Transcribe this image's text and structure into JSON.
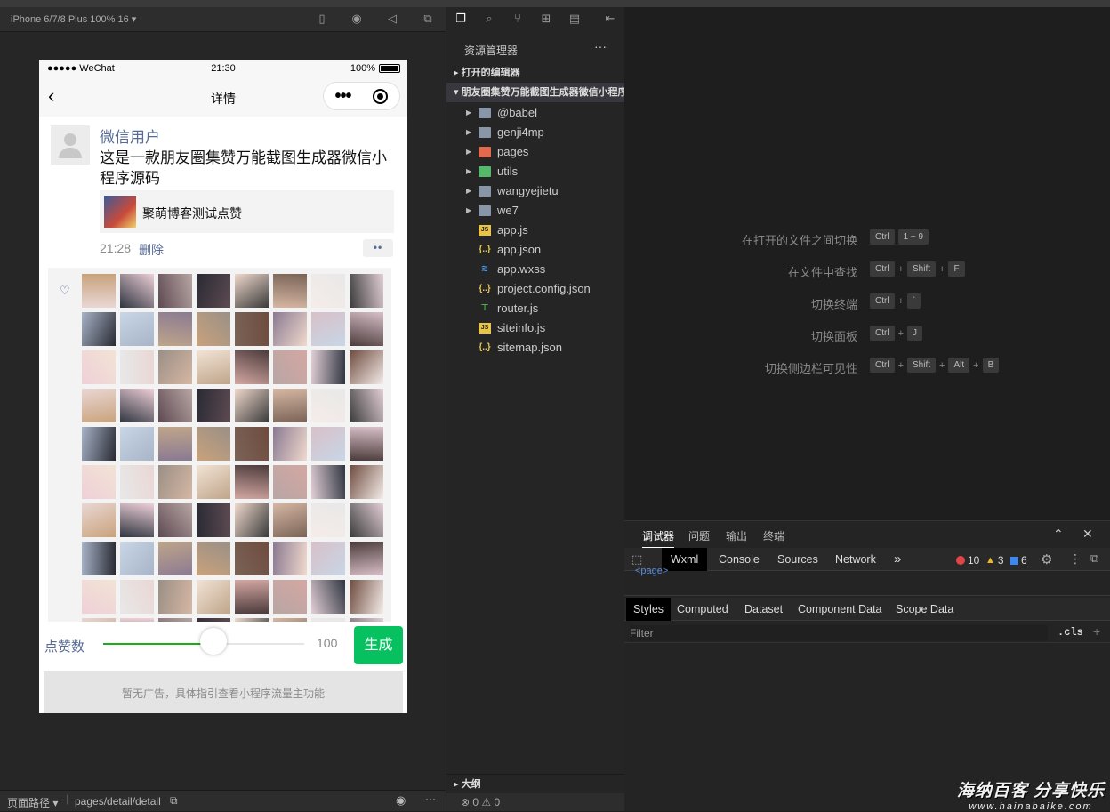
{
  "simulator": {
    "device_label": "iPhone 6/7/8 Plus 100% 16 ▾",
    "footer_path_label": "页面路径 ▾",
    "footer_path": "pages/detail/detail"
  },
  "phone": {
    "status": {
      "carrier": "●●●●● WeChat",
      "time": "21:30",
      "battery_pct": "100%"
    },
    "nav": {
      "back": "‹",
      "title": "详情",
      "capsule_dots": "•••"
    },
    "post": {
      "username": "微信用户",
      "text": "这是一款朋友圈集赞万能截图生成器微信小程序源码",
      "link_title": "聚萌博客测试点赞",
      "time": "21:28",
      "delete_label": "删除",
      "more_label": "••"
    },
    "likes_heart": "♡",
    "bottom": {
      "count_label": "点赞数",
      "count_value": "100",
      "slider_fraction": 0.55,
      "generate_label": "生成",
      "ad_text": "暂无广告，具体指引查看小程序流量主功能"
    }
  },
  "explorer": {
    "header": "资源管理器",
    "more": "···",
    "open_editors": "▸ 打开的编辑器",
    "project": "▾ 朋友圈集赞万能截图生成器微信小程序源码",
    "items": [
      {
        "name": "@babel",
        "kind": "folder",
        "arrow": "▶",
        "icon": "folder-icon"
      },
      {
        "name": "genji4mp",
        "kind": "folder",
        "arrow": "▶",
        "icon": "folder-icon"
      },
      {
        "name": "pages",
        "kind": "folder",
        "arrow": "▶",
        "icon": "pages-folder-icon"
      },
      {
        "name": "utils",
        "kind": "folder",
        "arrow": "▶",
        "icon": "utils-folder-icon"
      },
      {
        "name": "wangyejietu",
        "kind": "folder",
        "arrow": "▶",
        "icon": "folder-icon"
      },
      {
        "name": "we7",
        "kind": "folder",
        "arrow": "▶",
        "icon": "folder-icon"
      },
      {
        "name": "app.js",
        "kind": "js",
        "arrow": "",
        "icon": "js-file-icon",
        "glyph": "JS"
      },
      {
        "name": "app.json",
        "kind": "json",
        "arrow": "",
        "icon": "json-file-icon",
        "glyph": "{..}"
      },
      {
        "name": "app.wxss",
        "kind": "css",
        "arrow": "",
        "icon": "css-file-icon",
        "glyph": "≋"
      },
      {
        "name": "project.config.json",
        "kind": "json",
        "arrow": "",
        "icon": "json-file-icon",
        "glyph": "{..}"
      },
      {
        "name": "router.js",
        "kind": "router",
        "arrow": "",
        "icon": "router-file-icon",
        "glyph": "⊤"
      },
      {
        "name": "siteinfo.js",
        "kind": "js",
        "arrow": "",
        "icon": "js-file-icon",
        "glyph": "JS"
      },
      {
        "name": "sitemap.json",
        "kind": "json",
        "arrow": "",
        "icon": "json-file-icon",
        "glyph": "{..}"
      }
    ],
    "outline": "▸ 大纲",
    "footer": "⊗ 0 ⚠ 0"
  },
  "shortcuts": [
    {
      "label": "在打开的文件之间切换",
      "keys": [
        "Ctrl",
        "1 ~ 9"
      ]
    },
    {
      "label": "在文件中查找",
      "keys": [
        "Ctrl",
        "+",
        "Shift",
        "+",
        "F"
      ]
    },
    {
      "label": "切换终端",
      "keys": [
        "Ctrl",
        "+",
        "`"
      ]
    },
    {
      "label": "切换面板",
      "keys": [
        "Ctrl",
        "+",
        "J"
      ]
    },
    {
      "label": "切换侧边栏可见性",
      "keys": [
        "Ctrl",
        "+",
        "Shift",
        "+",
        "Alt",
        "+",
        "B"
      ]
    }
  ],
  "devtools": {
    "tabs": [
      "调试器",
      "问题",
      "输出",
      "终端"
    ],
    "panel_tabs": [
      "Wxml",
      "Console",
      "Sources",
      "Network"
    ],
    "more_panels": "»",
    "errors": "10",
    "warnings": "3",
    "infos": "6",
    "wxml_snippet": "<page>",
    "style_tabs": [
      "Styles",
      "Computed",
      "Dataset",
      "Component Data",
      "Scope Data"
    ],
    "filter_placeholder": "Filter",
    "cls_label": ".cls",
    "add_label": "+"
  },
  "watermark": {
    "line1": "海纳百客 分享快乐",
    "line2": "www.hainabaike.com"
  },
  "colors": {
    "accent_green": "#07c160",
    "wechat_link": "#576b95",
    "slider_fill": "#1aad19"
  }
}
